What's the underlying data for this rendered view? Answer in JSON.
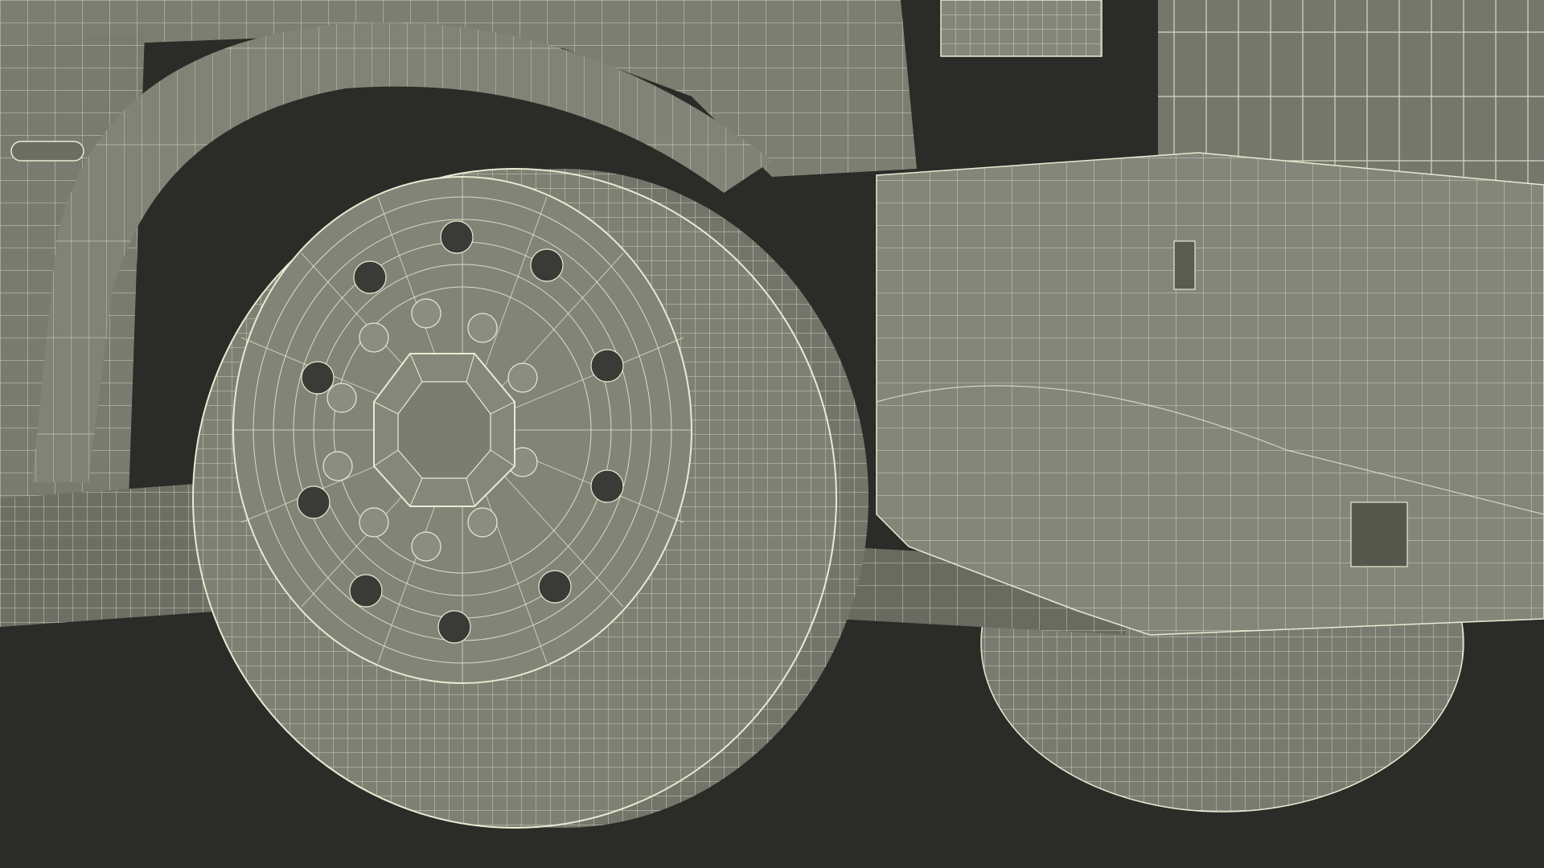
{
  "scene": {
    "subject": "truck-wheel-wireframe",
    "colors": {
      "background": "#2b2b28",
      "surface": "#7d7e72",
      "surface_light": "#8a8b7f",
      "surface_dark": "#5f6056",
      "hole": "#3a3b36",
      "wire": "#e9ead2"
    }
  }
}
